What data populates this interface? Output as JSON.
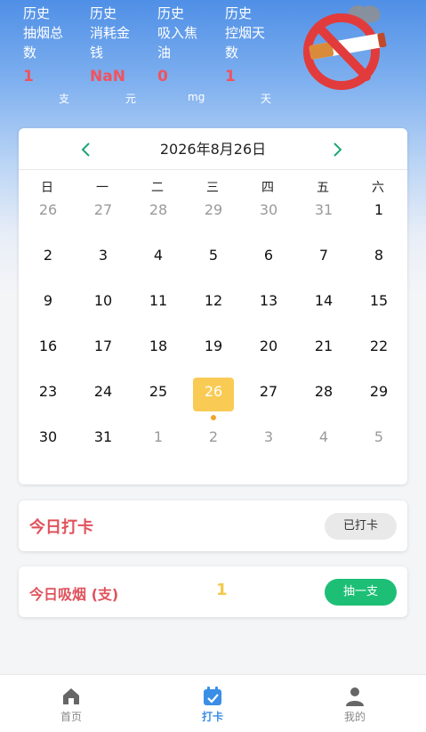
{
  "stats": [
    {
      "title": "历史\n抽烟总\n数",
      "value": "1",
      "unit": "支"
    },
    {
      "title": "历史\n消耗金\n钱",
      "value": "NaN",
      "unit": "元"
    },
    {
      "title": "历史\n吸入焦\n油",
      "value": "0",
      "unit": "mg"
    },
    {
      "title": "历史\n控烟天\n数",
      "value": "1",
      "unit": "天"
    }
  ],
  "hero_icon": "no-smoking-icon",
  "calendar": {
    "title": "2026年8月26日",
    "prev_icon": "chevron-left-icon",
    "next_icon": "chevron-right-icon",
    "weekdays": [
      "日",
      "一",
      "二",
      "三",
      "四",
      "五",
      "六"
    ],
    "days": [
      {
        "label": "26",
        "muted": true
      },
      {
        "label": "27",
        "muted": true
      },
      {
        "label": "28",
        "muted": true
      },
      {
        "label": "29",
        "muted": true
      },
      {
        "label": "30",
        "muted": true
      },
      {
        "label": "31",
        "muted": true
      },
      {
        "label": "1",
        "muted": false
      },
      {
        "label": "2",
        "muted": false
      },
      {
        "label": "3",
        "muted": false
      },
      {
        "label": "4",
        "muted": false
      },
      {
        "label": "5",
        "muted": false
      },
      {
        "label": "6",
        "muted": false
      },
      {
        "label": "7",
        "muted": false
      },
      {
        "label": "8",
        "muted": false
      },
      {
        "label": "9",
        "muted": false
      },
      {
        "label": "10",
        "muted": false
      },
      {
        "label": "11",
        "muted": false
      },
      {
        "label": "12",
        "muted": false
      },
      {
        "label": "13",
        "muted": false
      },
      {
        "label": "14",
        "muted": false
      },
      {
        "label": "15",
        "muted": false
      },
      {
        "label": "16",
        "muted": false
      },
      {
        "label": "17",
        "muted": false
      },
      {
        "label": "18",
        "muted": false
      },
      {
        "label": "19",
        "muted": false
      },
      {
        "label": "20",
        "muted": false
      },
      {
        "label": "21",
        "muted": false
      },
      {
        "label": "22",
        "muted": false
      },
      {
        "label": "23",
        "muted": false
      },
      {
        "label": "24",
        "muted": false
      },
      {
        "label": "25",
        "muted": false
      },
      {
        "label": "26",
        "muted": false,
        "selected": true,
        "marked": true
      },
      {
        "label": "27",
        "muted": false
      },
      {
        "label": "28",
        "muted": false
      },
      {
        "label": "29",
        "muted": false
      },
      {
        "label": "30",
        "muted": false
      },
      {
        "label": "31",
        "muted": false
      },
      {
        "label": "1",
        "muted": true
      },
      {
        "label": "2",
        "muted": true
      },
      {
        "label": "3",
        "muted": true
      },
      {
        "label": "4",
        "muted": true
      },
      {
        "label": "5",
        "muted": true
      }
    ]
  },
  "checkin": {
    "label": "今日打卡",
    "button": "已打卡"
  },
  "smoking": {
    "label": "今日吸烟 (支)",
    "count": "1",
    "button": "抽一支"
  },
  "tabs": [
    {
      "label": "首页",
      "icon": "home-icon",
      "active": false
    },
    {
      "label": "打卡",
      "icon": "calendar-check-icon",
      "active": true
    },
    {
      "label": "我的",
      "icon": "user-icon",
      "active": false
    }
  ],
  "colors": {
    "accent_blue": "#3a8ee6",
    "stat_value_red": "#f0535f",
    "selected_day": "#f9cb55",
    "green_button": "#1dbf76",
    "label_red": "#e0525c"
  }
}
